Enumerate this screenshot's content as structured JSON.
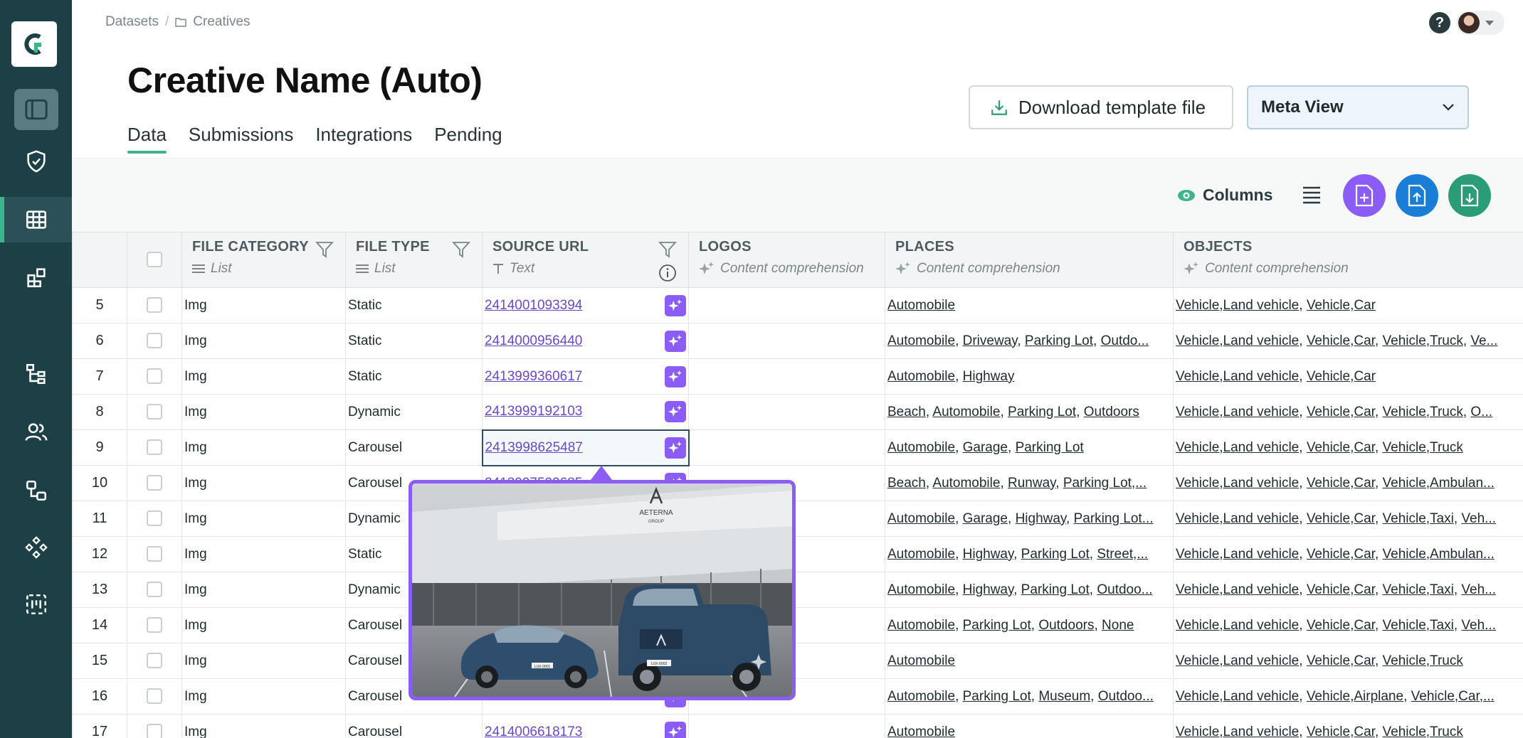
{
  "breadcrumb": {
    "root": "Datasets",
    "separator": "/",
    "current": "Creatives"
  },
  "page": {
    "title": "Creative Name (Auto)"
  },
  "tabs": [
    {
      "label": "Data",
      "active": true
    },
    {
      "label": "Submissions",
      "active": false
    },
    {
      "label": "Integrations",
      "active": false
    },
    {
      "label": "Pending",
      "active": false
    }
  ],
  "header": {
    "help_label": "?",
    "download_label": "Download template file",
    "view_select_value": "Meta View"
  },
  "toolbar": {
    "columns_label": "Columns"
  },
  "colors": {
    "sidebar": "#1d4047",
    "accent": "#3fb48a",
    "purple": "#8b5cf6",
    "blue": "#1b7ed6",
    "green": "#2a9d78"
  },
  "sidebar_icons": [
    "logo-icon",
    "sidebar-toggle-icon",
    "shield-check-icon",
    "table-icon",
    "widgets-icon",
    "hierarchy-icon",
    "users-icon",
    "workflow-icon",
    "components-icon",
    "scan-icon"
  ],
  "columns": [
    {
      "title": "FILE CATEGORY",
      "type": "List",
      "type_icon": "list-icon"
    },
    {
      "title": "FILE TYPE",
      "type": "List",
      "type_icon": "list-icon"
    },
    {
      "title": "SOURCE URL",
      "type": "Text",
      "type_icon": "text-icon"
    },
    {
      "title": "LOGOS",
      "type": "Content comprehension",
      "type_icon": "sparkle-icon"
    },
    {
      "title": "PLACES",
      "type": "Content comprehension",
      "type_icon": "sparkle-icon"
    },
    {
      "title": "OBJECTS",
      "type": "Content comprehension",
      "type_icon": "sparkle-icon"
    }
  ],
  "rows": [
    {
      "n": "5",
      "category": "Img",
      "type": "Static",
      "url": "2414001093394",
      "logos": "",
      "places": [
        "Automobile"
      ],
      "objects": [
        "Vehicle,Land vehicle",
        "Vehicle,Car"
      ]
    },
    {
      "n": "6",
      "category": "Img",
      "type": "Static",
      "url": "2414000956440",
      "logos": "",
      "places": [
        "Automobile",
        "Driveway",
        "Parking Lot",
        "Outdo..."
      ],
      "objects": [
        "Vehicle,Land vehicle",
        "Vehicle,Car",
        "Vehicle,Truck",
        "Ve..."
      ]
    },
    {
      "n": "7",
      "category": "Img",
      "type": "Static",
      "url": "2413999360617",
      "logos": "",
      "places": [
        "Automobile",
        "Highway"
      ],
      "objects": [
        "Vehicle,Land vehicle",
        "Vehicle,Car"
      ]
    },
    {
      "n": "8",
      "category": "Img",
      "type": "Dynamic",
      "url": "2413999192103",
      "logos": "",
      "places": [
        "Beach",
        "Automobile",
        "Parking Lot",
        "Outdoors"
      ],
      "objects": [
        "Vehicle,Land vehicle",
        "Vehicle,Car",
        "Vehicle,Truck",
        "O..."
      ]
    },
    {
      "n": "9",
      "category": "Img",
      "type": "Carousel",
      "url": "2413998625487",
      "logos": "",
      "places": [
        "Automobile",
        "Garage",
        "Parking Lot"
      ],
      "objects": [
        "Vehicle,Land vehicle",
        "Vehicle,Car",
        "Vehicle,Truck"
      ],
      "selected": true
    },
    {
      "n": "10",
      "category": "Img",
      "type": "Carousel",
      "url": "2413997599685",
      "logos": "",
      "places": [
        "Beach",
        "Automobile",
        "Runway",
        "Parking Lot,..."
      ],
      "objects": [
        "Vehicle,Land vehicle",
        "Vehicle,Car",
        "Vehicle,Ambulan..."
      ]
    },
    {
      "n": "11",
      "category": "Img",
      "type": "Dynamic",
      "url": "",
      "logos": "",
      "places": [
        "Automobile",
        "Garage",
        "Highway",
        "Parking Lot..."
      ],
      "objects": [
        "Vehicle,Land vehicle",
        "Vehicle,Car",
        "Vehicle,Taxi",
        "Veh..."
      ]
    },
    {
      "n": "12",
      "category": "Img",
      "type": "Static",
      "url": "",
      "logos": "",
      "places": [
        "Automobile",
        "Highway",
        "Parking Lot",
        "Street,..."
      ],
      "objects": [
        "Vehicle,Land vehicle",
        "Vehicle,Car",
        "Vehicle,Ambulan..."
      ]
    },
    {
      "n": "13",
      "category": "Img",
      "type": "Dynamic",
      "url": "",
      "logos": "",
      "places": [
        "Automobile",
        "Highway",
        "Parking Lot",
        "Outdoo..."
      ],
      "objects": [
        "Vehicle,Land vehicle",
        "Vehicle,Car",
        "Vehicle,Taxi",
        "Veh..."
      ]
    },
    {
      "n": "14",
      "category": "Img",
      "type": "Carousel",
      "url": "",
      "logos": "",
      "places": [
        "Automobile",
        "Parking Lot",
        "Outdoors",
        "None"
      ],
      "objects": [
        "Vehicle,Land vehicle",
        "Vehicle,Car",
        "Vehicle,Taxi",
        "Veh..."
      ]
    },
    {
      "n": "15",
      "category": "Img",
      "type": "Carousel",
      "url": "",
      "logos": "",
      "places": [
        "Automobile"
      ],
      "objects": [
        "Vehicle,Land vehicle",
        "Vehicle,Car",
        "Vehicle,Truck"
      ]
    },
    {
      "n": "16",
      "category": "Img",
      "type": "Carousel",
      "url": "",
      "logos": "",
      "places": [
        "Automobile",
        "Parking Lot",
        "Museum",
        "Outdoo..."
      ],
      "objects": [
        "Vehicle,Land vehicle",
        "Vehicle,Airplane",
        "Vehicle,Car,..."
      ]
    },
    {
      "n": "17",
      "category": "Img",
      "type": "Carousel",
      "url": "2414006618173",
      "logos": "",
      "places": [
        "Automobile"
      ],
      "objects": [
        "Vehicle,Land vehicle",
        "Vehicle,Car",
        "Vehicle,Truck"
      ]
    }
  ],
  "popover": {
    "image": "preview-image",
    "building_sign": "AETERNA",
    "building_sign_sub": "GROUP",
    "plate_left": "LUX·0001",
    "plate_right": "LUX·0002"
  }
}
